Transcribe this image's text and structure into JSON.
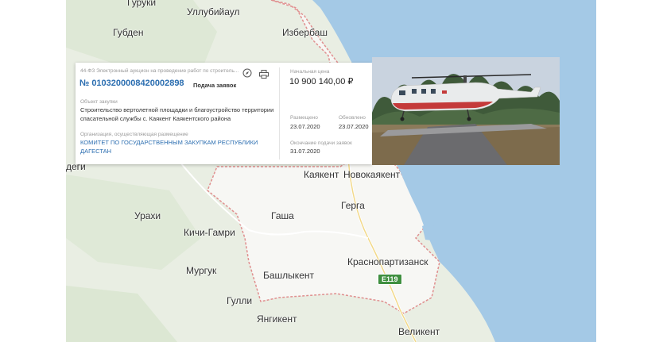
{
  "map": {
    "towns": {
      "guruki": "Гуруки",
      "ullubiyaul": "Уллубийаул",
      "gubden": "Губден",
      "izberbash": "Избербаш",
      "degi": "деги",
      "kayakent": "Каякент",
      "novokayakent": "Новокаякент",
      "urakhi": "Урахи",
      "gasha": "Гаша",
      "gerga": "Герга",
      "kichi_gamri": "Кичи-Гамри",
      "murguk": "Мургук",
      "bashlykent": "Башлыкент",
      "krasnopartizansk": "Краснопартизанск",
      "gulli": "Гулли",
      "yangikent": "Янгикент",
      "velikent": "Великент"
    },
    "road_shield": "E119",
    "colors": {
      "sea": "#a4c9e6",
      "land": "#e9eee3",
      "border": "#e08f8f",
      "highlight": "#ffffff"
    }
  },
  "card": {
    "procedure": "44-ФЗ Электронный аукцион на проведение работ по строитель...",
    "number": "№ 0103200008420002898",
    "status": "Подача заявок",
    "object_label": "Объект закупки",
    "object_text": "Строительство вертолетной площадки и благоустройство территории спасательной службы с. Каякент Каякентского района",
    "org_label": "Организация, осуществляющая размещение",
    "org_name": "КОМИТЕТ ПО ГОСУДАРСТВЕННЫМ ЗАКУПКАМ РЕСПУБЛИКИ ДАГЕСТАН",
    "price_label": "Начальная цена",
    "price": "10 900 140,00 ₽",
    "posted_label": "Размещено",
    "posted_date": "23.07.2020",
    "updated_label": "Обновлено",
    "updated_date": "23.07.2020",
    "deadline_label": "Окончание подачи заявок",
    "deadline_date": "31.07.2020",
    "icons": [
      "compass-icon",
      "print-icon"
    ]
  }
}
